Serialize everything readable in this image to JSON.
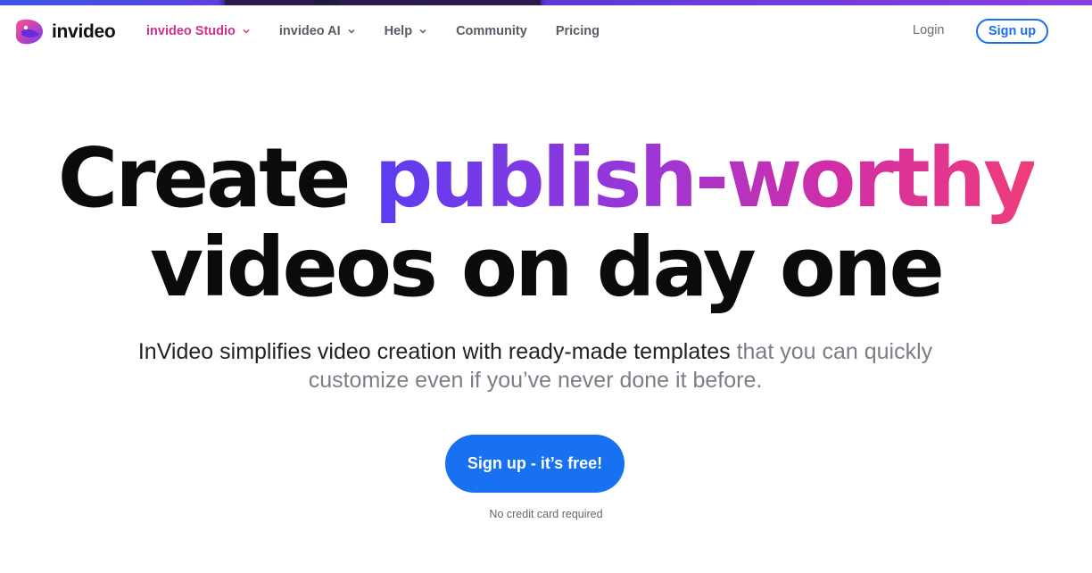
{
  "brand": {
    "name": "invideo",
    "logo_icon": "invideo-logo-icon",
    "colors": {
      "primary_blue": "#1771f1",
      "active_pink": "#d2308e",
      "gradient_start": "#5b3df0",
      "gradient_end": "#ef3d7a"
    }
  },
  "nav": {
    "items": [
      {
        "label": "invideo Studio",
        "has_dropdown": true,
        "active": true
      },
      {
        "label": "invideo AI",
        "has_dropdown": true,
        "active": false
      },
      {
        "label": "Help",
        "has_dropdown": true,
        "active": false
      },
      {
        "label": "Community",
        "has_dropdown": false,
        "active": false
      },
      {
        "label": "Pricing",
        "has_dropdown": false,
        "active": false
      }
    ],
    "login_label": "Login",
    "signup_label": "Sign up"
  },
  "hero": {
    "title_part1": "Create ",
    "title_highlight": "publish-worthy",
    "title_line2": "videos on day one",
    "subtitle_main": "InVideo simplifies video creation with ready-made templates",
    "subtitle_muted": " that you can quickly customize even if you’ve never done it before.",
    "cta_label": "Sign up - it’s free!",
    "note": "No credit card required"
  }
}
